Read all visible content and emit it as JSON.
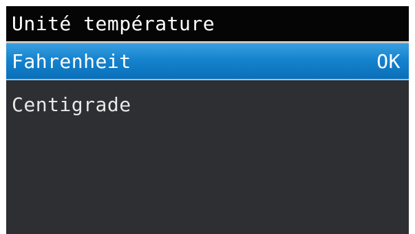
{
  "screen": {
    "title": "Unité température"
  },
  "menu": {
    "items": [
      {
        "label": "Fahrenheit",
        "state": "OK",
        "selected": true
      },
      {
        "label": "Centigrade",
        "state": "",
        "selected": false
      }
    ]
  },
  "colors": {
    "title_bar": "#050505",
    "selection": "#1583cf",
    "background": "#2d2f33",
    "text": "#ffffff"
  }
}
